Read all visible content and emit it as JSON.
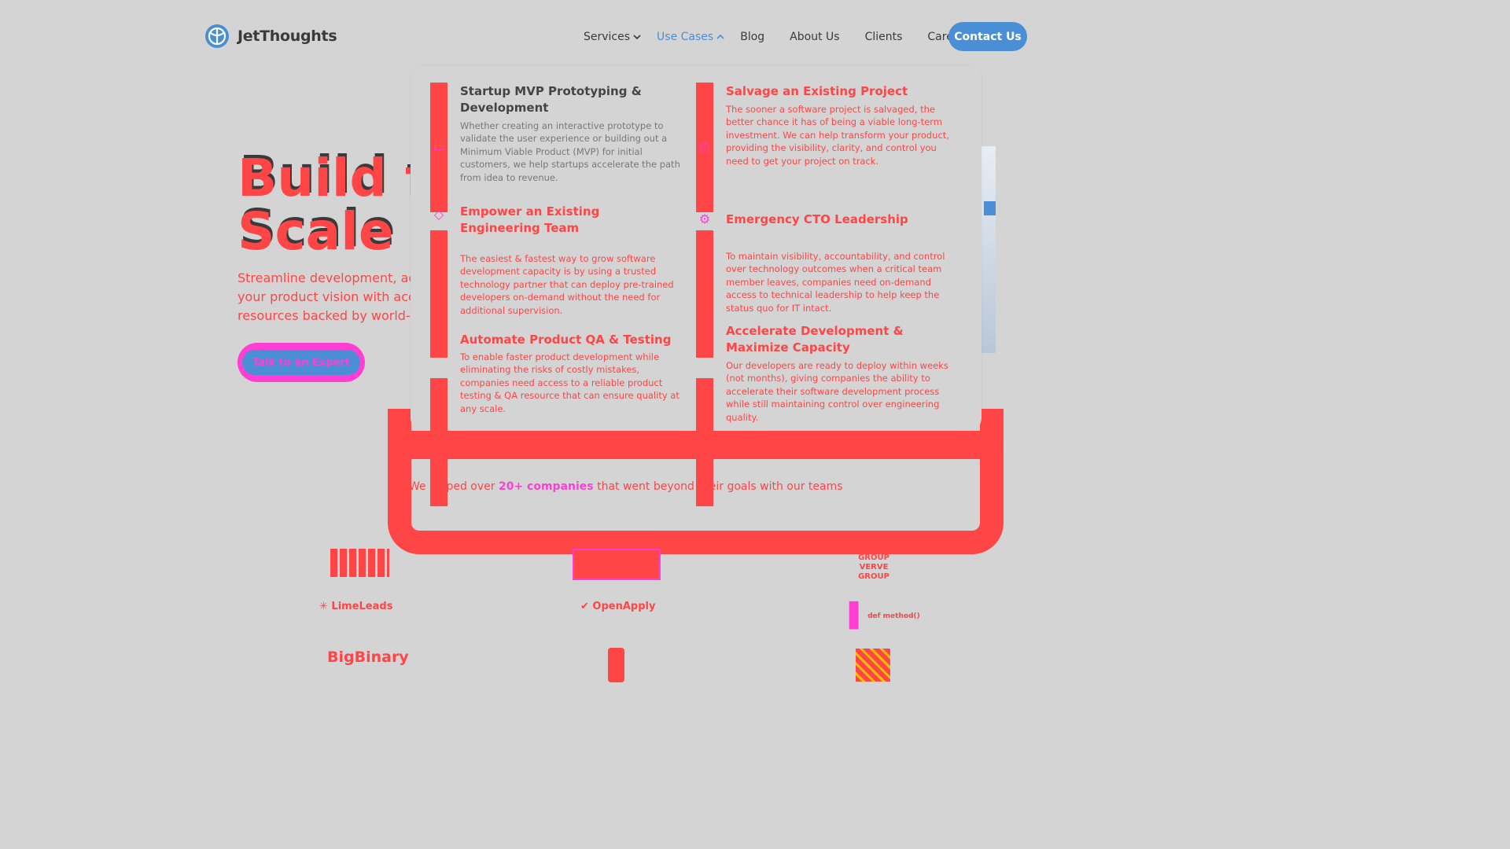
{
  "brand": {
    "name": "JetThoughts",
    "logo_icon": "globe-icon",
    "accent": "#4a8fd6",
    "highlight": "#ff4545",
    "pink": "#ff3fd3"
  },
  "nav": {
    "items": [
      {
        "label": "Services",
        "has_dropdown": true
      },
      {
        "label": "Use Cases",
        "has_dropdown": true,
        "active": true
      },
      {
        "label": "Blog"
      },
      {
        "label": "About Us"
      },
      {
        "label": "Clients"
      },
      {
        "label": "Careers"
      }
    ],
    "contact_label": "Contact Us"
  },
  "hero": {
    "title_line1": "Build fa",
    "title_line2": "Scale s",
    "subtitle_lines": [
      "Streamline development, acc",
      "your product vision with acce",
      "resources backed by world-cl"
    ],
    "cta_label": "Talk to an Expert"
  },
  "dropdown": {
    "use_cases": [
      {
        "title": "Startup MVP Prototyping & Development",
        "description": "Whether creating an interactive prototype to validate the user experience or building out a Minimum Viable Product (MVP) for initial customers, we help startups accelerate the path from idea to revenue.",
        "icon": "screen-icon"
      },
      {
        "title": "Salvage an Existing Project",
        "description": "The sooner a software project is salvaged, the better chance it has of being a viable long-term investment. We can help transform your product, providing the visibility, clarity, and control you need to get your project on track.",
        "icon": "lifebuoy-icon"
      },
      {
        "title": "Empower an Existing Engineering Team",
        "description": "The easiest & fastest way to grow software development capacity is by using a trusted technology partner that can deploy pre-trained developers on-demand without the need for additional supervision.",
        "icon": "diamond-icon"
      },
      {
        "title": "Emergency CTO Leadership",
        "description": "To maintain visibility, accountability, and control over technology outcomes when a critical team member leaves, companies need on-demand access to technical leadership to help keep the status quo for IT intact.",
        "icon": "gear-icon"
      },
      {
        "title": "Automate Product QA & Testing",
        "description": "To enable faster product development while eliminating the risks of costly mistakes, companies need access to a reliable product testing & QA resource that can ensure quality at any scale.",
        "icon": "check-icon"
      },
      {
        "title": "Accelerate Development & Maximize Capacity",
        "description": "Our developers are ready to deploy within weeks (not months), giving companies the ability to accelerate their software development process while still maintaining control over engineering quality.",
        "icon": "rocket-icon"
      }
    ]
  },
  "clients": {
    "intro_before": "We helped over ",
    "intro_highlight": "20+ companies",
    "intro_after": " that went beyond their goals with our teams",
    "logos": [
      "LimeLeads",
      "OpenApply",
      "def method()",
      "BigBinary",
      "GROUP VERVE GROUP"
    ]
  }
}
